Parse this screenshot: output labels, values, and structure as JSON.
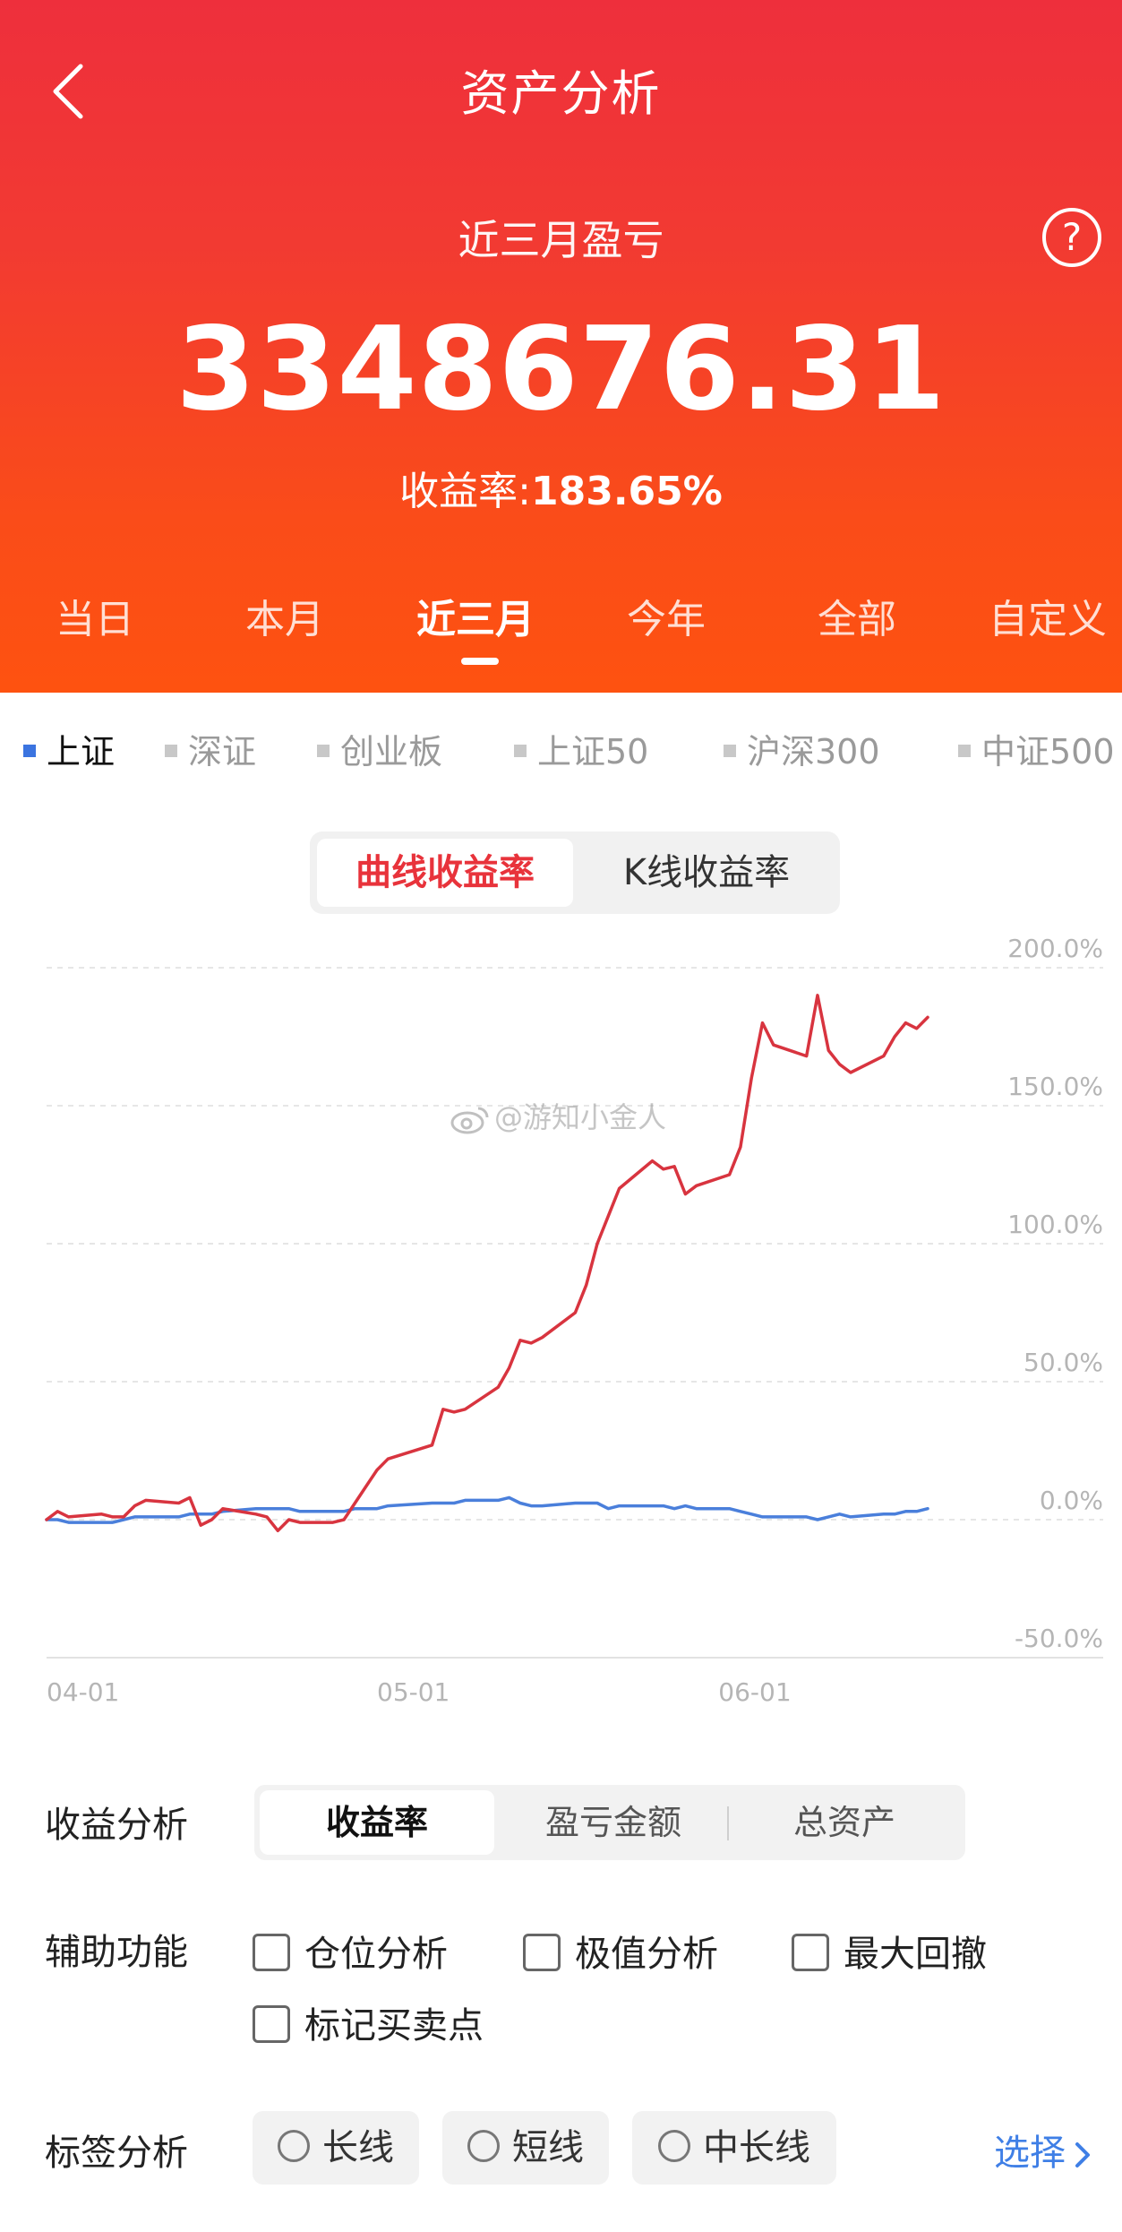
{
  "header": {
    "title": "资产分析",
    "period_label": "近三月盈亏",
    "pnl_value": "3348676.31",
    "return_label": "收益率:",
    "return_value": "183.65%",
    "help_icon": "question-circle-icon",
    "back_icon": "chevron-left-icon"
  },
  "tabs": [
    {
      "label": "当日",
      "active": false
    },
    {
      "label": "本月",
      "active": false
    },
    {
      "label": "近三月",
      "active": true
    },
    {
      "label": "今年",
      "active": false
    },
    {
      "label": "全部",
      "active": false
    },
    {
      "label": "自定义",
      "active": false
    }
  ],
  "indices": [
    {
      "label": "上证",
      "active": true
    },
    {
      "label": "深证",
      "active": false
    },
    {
      "label": "创业板",
      "active": false
    },
    {
      "label": "上证50",
      "active": false
    },
    {
      "label": "沪深300",
      "active": false
    },
    {
      "label": "中证500",
      "active": false
    }
  ],
  "chart_mode": {
    "options": [
      "曲线收益率",
      "K线收益率"
    ],
    "selected": "曲线收益率"
  },
  "watermark": "@游知小金人",
  "colors": {
    "accent_red": "#e8333b",
    "series_red": "#d8343f",
    "series_blue": "#4a7fdb",
    "link_blue": "#3f7fe6"
  },
  "chart_data": {
    "type": "line",
    "x_tick_labels": [
      "04-01",
      "05-01",
      "06-01"
    ],
    "y_tick_labels": [
      "200.0%",
      "150.0%",
      "100.0%",
      "50.0%",
      "0.0%",
      "-50.0%"
    ],
    "ylim": [
      -50,
      200
    ],
    "grid": true,
    "x": [
      "04-01",
      "04-02",
      "04-03",
      "04-06",
      "04-07",
      "04-08",
      "04-09",
      "04-10",
      "04-13",
      "04-14",
      "04-15",
      "04-16",
      "04-17",
      "04-20",
      "04-21",
      "04-22",
      "04-23",
      "04-24",
      "04-27",
      "04-28",
      "04-29",
      "04-30",
      "05-01",
      "05-02",
      "05-06",
      "05-07",
      "05-08",
      "05-09",
      "05-12",
      "05-13",
      "05-14",
      "05-15",
      "05-16",
      "05-19",
      "05-20",
      "05-21",
      "05-22",
      "05-23",
      "05-26",
      "05-27",
      "05-28",
      "05-29",
      "05-30",
      "06-02",
      "06-03",
      "06-04",
      "06-05",
      "06-06",
      "06-09",
      "06-10",
      "06-11",
      "06-12",
      "06-13",
      "06-16",
      "06-17",
      "06-18",
      "06-19",
      "06-20"
    ],
    "series": [
      {
        "values": [
          0,
          3,
          1,
          2,
          1,
          1,
          5,
          7,
          6,
          8,
          -2,
          0,
          4,
          2,
          1,
          -4,
          0,
          -1,
          -1,
          0,
          6,
          12,
          18,
          22,
          27,
          40,
          39,
          40,
          48,
          55,
          65,
          64,
          66,
          75,
          85,
          100,
          110,
          120,
          130,
          127,
          128,
          118,
          121,
          125,
          135,
          160,
          180,
          172,
          168,
          190,
          170,
          165,
          162,
          168,
          175,
          180,
          178,
          182
        ]
      },
      {
        "values": [
          0,
          0,
          -1,
          -1,
          -1,
          0,
          1,
          1,
          1,
          2,
          2,
          2,
          3,
          4,
          4,
          4,
          4,
          3,
          3,
          3,
          4,
          4,
          4,
          5,
          6,
          6,
          6,
          7,
          7,
          8,
          6,
          5,
          5,
          6,
          6,
          6,
          4,
          5,
          5,
          5,
          4,
          5,
          4,
          4,
          3,
          2,
          1,
          1,
          1,
          0,
          1,
          2,
          1,
          2,
          2,
          3,
          3,
          4
        ]
      }
    ]
  },
  "analysis": {
    "label": "收益分析",
    "options": [
      "收益率",
      "盈亏金额",
      "总资产"
    ],
    "selected": "收益率"
  },
  "aux": {
    "label": "辅助功能",
    "options": [
      "仓位分析",
      "极值分析",
      "最大回撤",
      "标记买卖点"
    ]
  },
  "tags": {
    "label": "标签分析",
    "options": [
      "长线",
      "短线",
      "中长线"
    ],
    "select_label": "选择"
  }
}
